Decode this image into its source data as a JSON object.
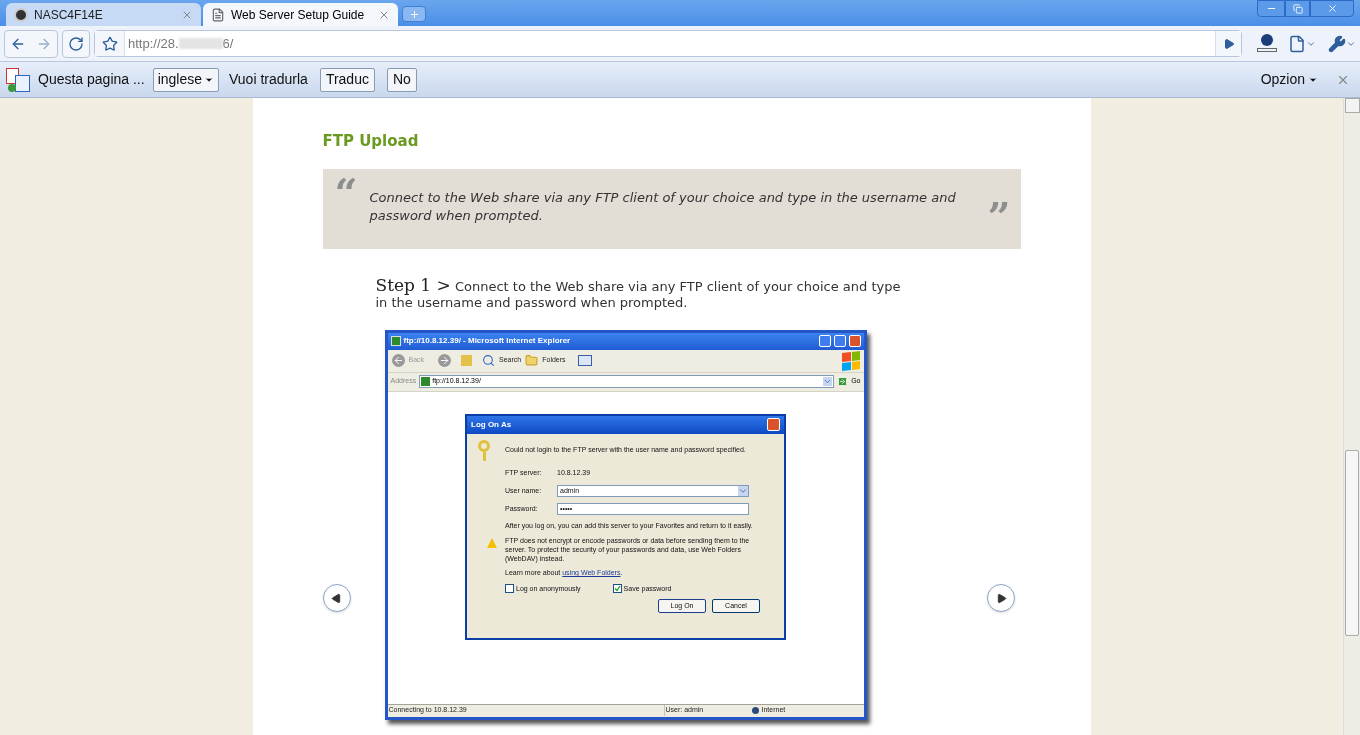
{
  "browser": {
    "tabs": [
      {
        "title": "NASC4F14E",
        "selected": false
      },
      {
        "title": "Web Server Setup Guide",
        "selected": true
      }
    ],
    "address": {
      "start": "http://28.",
      "end": "6/"
    },
    "translate_bar": {
      "message": "Questa pagina ...",
      "language": "inglese",
      "prompt": "Vuoi tradurla",
      "buttons": [
        "Traduc",
        "No"
      ],
      "options": "Opzion"
    }
  },
  "page": {
    "heading": "FTP Upload",
    "quote": {
      "open": "“",
      "text": "Connect to the Web share via any FTP client of your choice and type in the username and password when prompted.",
      "close": "”"
    },
    "step": {
      "label": "Step 1",
      "separator": ">",
      "text": "Connect to the Web share via any FTP client of your choice and type in the username and password when prompted."
    },
    "screenshot": {
      "title": "ftp://10.8.12.39/ - Microsoft Internet Explorer",
      "toolbar": [
        "Back",
        "Search",
        "Folders"
      ],
      "address_label": "Address",
      "address": "ftp://10.8.12.39/",
      "go": "Go",
      "dialog": {
        "title": "Log On As",
        "message": "Could not login to the FTP server with the user name and password specified.",
        "fields": [
          {
            "label": "FTP server:",
            "value": "10.8.12.39",
            "kind": "text"
          },
          {
            "label": "User name:",
            "value": "admin",
            "kind": "combo"
          },
          {
            "label": "Password:",
            "value": "•••••",
            "kind": "password"
          }
        ],
        "info": "After you log on, you can add this server to your Favorites and return to it easily.",
        "warning": "FTP does not encrypt or encode passwords or data before sending them to the server.  To protect the security of your passwords and data, use Web Folders (WebDAV) instead.",
        "learn": {
          "text": "Learn more about",
          "link": "using Web Folders",
          "end": "."
        },
        "checkboxes": [
          {
            "label": "Log on anonymously",
            "checked": false
          },
          {
            "label": "Save password",
            "checked": true
          }
        ],
        "buttons": [
          "Log On",
          "Cancel"
        ]
      },
      "status": [
        "Connecting to 10.8.12.39",
        "User: admin",
        "Internet"
      ]
    }
  }
}
